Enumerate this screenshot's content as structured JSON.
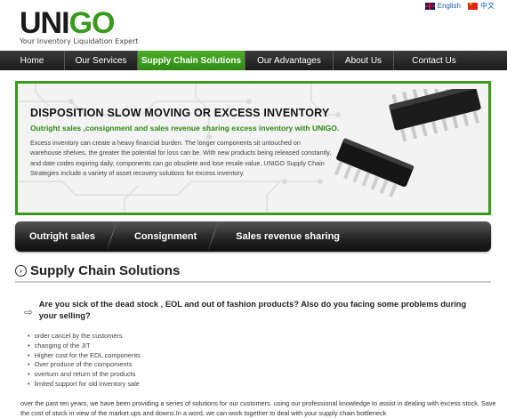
{
  "brand": {
    "logo_part1": "UNI",
    "logo_part2": "GO",
    "tagline": "Your Inventory Liquidation Expert"
  },
  "languages": [
    {
      "label": "English",
      "flag": "uk-flag-icon"
    },
    {
      "label": "中文",
      "flag": "cn-flag-icon"
    }
  ],
  "nav": {
    "items": [
      {
        "label": "Home"
      },
      {
        "label": "Our Services"
      },
      {
        "label": "Supply Chain Solutions",
        "active": true
      },
      {
        "label": "Our Advantages"
      },
      {
        "label": "About Us"
      },
      {
        "label": "Contact Us"
      }
    ]
  },
  "banner": {
    "title": "DISPOSITION SLOW MOVING OR EXCESS INVENTORY",
    "subtitle": "Outright sales ,consignment and sales revenue sharing excess inventory with UNIGO.",
    "body": "Excess inventory can create a heavy financial burden. The longer components sit untouched on warehouse shelves, the greater the potential for loss can be. With new products being released constantly, and date codes expiring daily, components can go obsolete and lose resale value. UNIGO Supply Chain Strategies include a variety of asset recovery solutions for excess inventory."
  },
  "tabs": [
    {
      "label": "Outright sales"
    },
    {
      "label": "Consignment"
    },
    {
      "label": "Sales revenue sharing"
    }
  ],
  "section": {
    "title": "Supply Chain Solutions"
  },
  "question": {
    "text": "Are you sick of the dead stock , EOL and out of fashion products? Also do you facing some problems during your selling?"
  },
  "bullets": [
    "order cancel by the customers",
    "changing of the JIT",
    "Higher cost for the EOL components",
    "Over produce of the compoments",
    "overturn and return of the products",
    "limited support for old inventory sale"
  ],
  "paragraph": "over the past ten years, we have been providing a series of solutions for our customers. using our professional knowledge to assist in dealing with excess stock. Save the cost of stock in view of the market ups and downs.In a word, we can work together to deal with your supply chain bottleneck",
  "colors": {
    "accent_green": "#3a9a1e",
    "nav_dark": "#1a1a1a"
  }
}
